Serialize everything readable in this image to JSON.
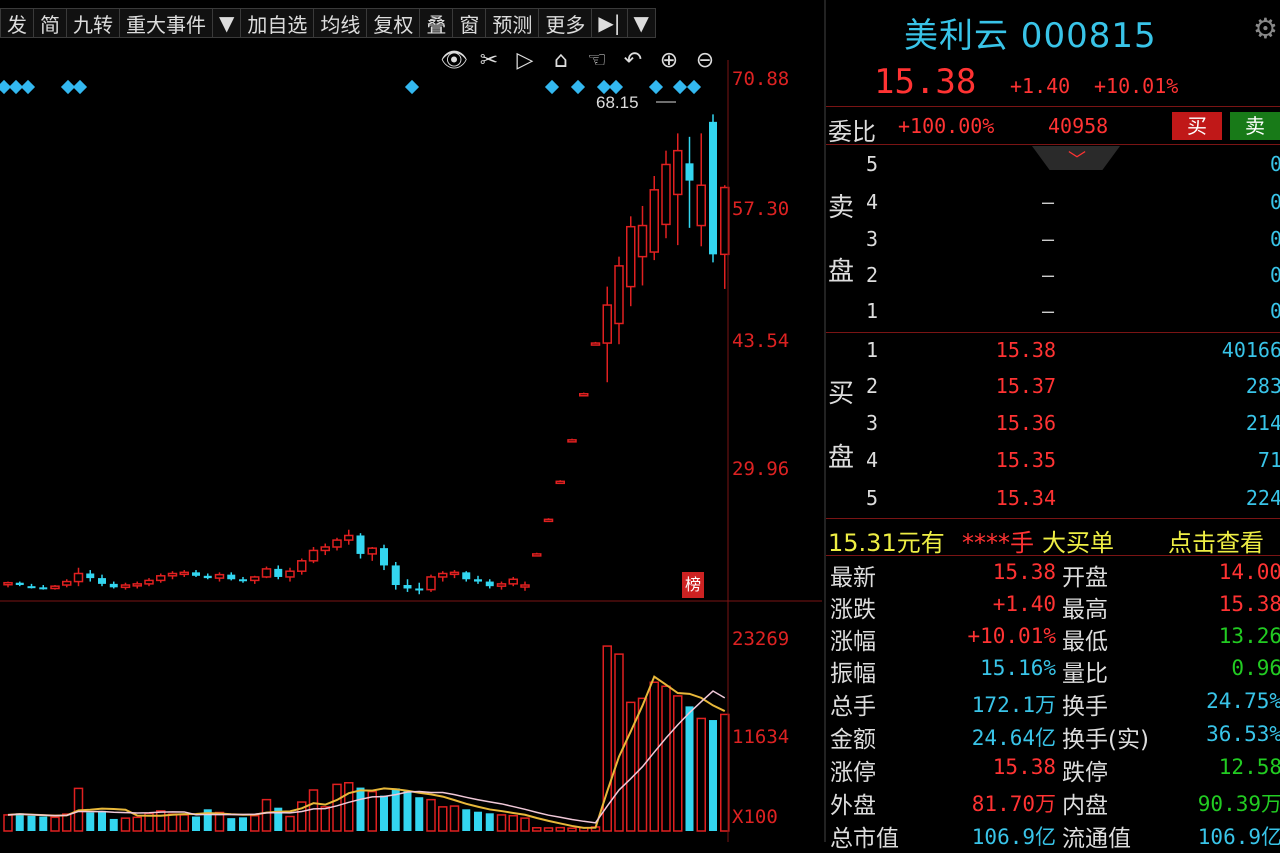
{
  "toolbar": {
    "items": [
      "发",
      "简",
      "九转",
      "重大事件",
      "▼",
      "加自选",
      "均线",
      "复权",
      "叠",
      "窗",
      "预测",
      "更多",
      "▶|",
      "▼"
    ]
  },
  "chart": {
    "price_axis": [
      "70.88",
      "57.30",
      "43.54",
      "29.96"
    ],
    "volume_axis": [
      "23269",
      "11634",
      "X100"
    ],
    "high_label": "68.15",
    "rank_badge": "榜",
    "colors": {
      "up": "#e02020",
      "down": "#33d6f0",
      "ma_yellow": "#e8b83a",
      "ma_pink": "#f0c8d8"
    }
  },
  "chart_data": {
    "type": "candlestick",
    "price_ylim": [
      26,
      72
    ],
    "candles": [
      [
        27.4,
        27.6,
        27.1,
        27.5
      ],
      [
        27.5,
        27.6,
        27.2,
        27.3
      ],
      [
        27.2,
        27.4,
        27.0,
        27.1
      ],
      [
        27.1,
        27.3,
        26.9,
        27.0
      ],
      [
        27.0,
        27.3,
        26.9,
        27.2
      ],
      [
        27.3,
        27.8,
        27.1,
        27.6
      ],
      [
        27.6,
        28.8,
        27.2,
        28.3
      ],
      [
        28.3,
        28.6,
        27.6,
        27.9
      ],
      [
        27.9,
        28.2,
        27.2,
        27.4
      ],
      [
        27.4,
        27.6,
        27.0,
        27.1
      ],
      [
        27.1,
        27.5,
        26.9,
        27.3
      ],
      [
        27.3,
        27.6,
        27.0,
        27.4
      ],
      [
        27.4,
        27.9,
        27.2,
        27.7
      ],
      [
        27.7,
        28.3,
        27.5,
        28.1
      ],
      [
        28.1,
        28.5,
        27.8,
        28.3
      ],
      [
        28.3,
        28.6,
        28.0,
        28.4
      ],
      [
        28.4,
        28.6,
        28.0,
        28.1
      ],
      [
        28.1,
        28.3,
        27.8,
        27.9
      ],
      [
        27.9,
        28.4,
        27.6,
        28.2
      ],
      [
        28.2,
        28.4,
        27.7,
        27.8
      ],
      [
        27.8,
        28.0,
        27.5,
        27.7
      ],
      [
        27.7,
        28.1,
        27.4,
        28.0
      ],
      [
        28.0,
        28.9,
        27.9,
        28.7
      ],
      [
        28.7,
        29.0,
        27.8,
        28.0
      ],
      [
        28.0,
        28.8,
        27.6,
        28.5
      ],
      [
        28.5,
        29.6,
        28.2,
        29.4
      ],
      [
        29.4,
        30.6,
        29.2,
        30.3
      ],
      [
        30.3,
        30.9,
        29.9,
        30.6
      ],
      [
        30.6,
        31.4,
        30.3,
        31.2
      ],
      [
        31.2,
        32.1,
        30.8,
        31.6
      ],
      [
        31.6,
        31.8,
        29.6,
        30.0
      ],
      [
        30.0,
        30.6,
        29.4,
        30.5
      ],
      [
        30.5,
        30.8,
        28.6,
        29.0
      ],
      [
        29.0,
        29.3,
        26.9,
        27.3
      ],
      [
        27.3,
        27.8,
        26.7,
        27.0
      ],
      [
        27.0,
        27.5,
        26.5,
        26.9
      ],
      [
        26.9,
        28.2,
        26.7,
        28.0
      ],
      [
        28.0,
        28.5,
        27.6,
        28.3
      ],
      [
        28.3,
        28.6,
        27.9,
        28.4
      ],
      [
        28.4,
        28.5,
        27.6,
        27.8
      ],
      [
        27.8,
        28.1,
        27.4,
        27.6
      ],
      [
        27.6,
        27.8,
        27.0,
        27.2
      ],
      [
        27.2,
        27.6,
        26.9,
        27.4
      ],
      [
        27.4,
        28.0,
        27.2,
        27.8
      ],
      [
        27.2,
        27.6,
        26.8,
        27.3
      ],
      [
        30.0,
        30.1,
        29.9,
        30.0
      ],
      [
        33.0,
        33.1,
        32.9,
        33.0
      ],
      [
        36.3,
        36.4,
        36.2,
        36.3
      ],
      [
        39.9,
        40.0,
        39.8,
        39.9
      ],
      [
        43.9,
        44.0,
        43.8,
        43.9
      ],
      [
        48.3,
        48.4,
        48.2,
        48.3
      ],
      [
        48.3,
        53.2,
        44.9,
        51.6
      ],
      [
        50.0,
        55.8,
        48.2,
        55.0
      ],
      [
        53.2,
        59.3,
        51.5,
        58.4
      ],
      [
        55.8,
        60.2,
        53.3,
        58.5
      ],
      [
        56.2,
        62.8,
        55.5,
        61.6
      ],
      [
        58.6,
        65.0,
        57.4,
        63.8
      ],
      [
        61.2,
        66.5,
        56.8,
        65.0
      ],
      [
        63.9,
        66.2,
        58.3,
        62.4
      ],
      [
        58.5,
        66.5,
        56.7,
        62.0
      ],
      [
        67.5,
        68.15,
        55.3,
        56.0
      ],
      [
        56.0,
        62.0,
        53.0,
        61.8
      ]
    ],
    "volume_ylim": [
      0,
      25000
    ],
    "volume": [
      2000,
      2200,
      1900,
      1800,
      1700,
      2100,
      5300,
      2300,
      2500,
      1500,
      1600,
      1700,
      2200,
      2500,
      2100,
      2000,
      1800,
      2700,
      2300,
      1600,
      1700,
      1900,
      3900,
      2900,
      1800,
      3600,
      5100,
      3000,
      5800,
      6000,
      5400,
      4900,
      4400,
      5300,
      5000,
      4200,
      3900,
      3000,
      3100,
      2700,
      2400,
      2200,
      2000,
      1900,
      1600,
      400,
      380,
      420,
      350,
      410,
      500,
      23000,
      22000,
      16000,
      16500,
      18500,
      18000,
      16800,
      15500,
      14000,
      13800,
      14500
    ]
  },
  "quote": {
    "name": "美利云 000815",
    "price": "15.38",
    "change": "+1.40",
    "pct": "+10.01%",
    "weibi_label": "委比",
    "weibi_val": "+100.00%",
    "weibi_diff": "40958",
    "buy_btn": "买",
    "sell_btn": "卖",
    "sell_label_1": "卖",
    "sell_label_2": "盘",
    "buy_label_1": "买",
    "buy_label_2": "盘",
    "asks": [
      {
        "lvl": "5",
        "price": "",
        "vol": "0"
      },
      {
        "lvl": "4",
        "price": "—",
        "vol": "0"
      },
      {
        "lvl": "3",
        "price": "—",
        "vol": "0"
      },
      {
        "lvl": "2",
        "price": "—",
        "vol": "0"
      },
      {
        "lvl": "1",
        "price": "—",
        "vol": "0"
      }
    ],
    "bids": [
      {
        "lvl": "1",
        "price": "15.38",
        "vol": "40166"
      },
      {
        "lvl": "2",
        "price": "15.37",
        "vol": "283"
      },
      {
        "lvl": "3",
        "price": "15.36",
        "vol": "214"
      },
      {
        "lvl": "4",
        "price": "15.35",
        "vol": "71"
      },
      {
        "lvl": "5",
        "price": "15.34",
        "vol": "224"
      }
    ],
    "bigorder": {
      "a": "15.31元有",
      "b": "****手",
      "c": "大买单",
      "d": "点击查看"
    },
    "stats": [
      {
        "k1": "最新",
        "v1": "15.38",
        "c1": "red",
        "k2": "开盘",
        "v2": "14.00",
        "c2": "red"
      },
      {
        "k1": "涨跌",
        "v1": "+1.40",
        "c1": "red",
        "k2": "最高",
        "v2": "15.38",
        "c2": "red"
      },
      {
        "k1": "涨幅",
        "v1": "+10.01%",
        "c1": "red",
        "k2": "最低",
        "v2": "13.26",
        "c2": "green"
      },
      {
        "k1": "振幅",
        "v1": "15.16%",
        "c1": "cyan",
        "k2": "量比",
        "v2": "0.96",
        "c2": "green"
      },
      {
        "k1": "总手",
        "v1": "172.1万",
        "c1": "cyan",
        "k2": "换手",
        "v2": "24.75%",
        "c2": "cyan"
      },
      {
        "k1": "金额",
        "v1": "24.64亿",
        "c1": "cyan",
        "k2": "换手(实)",
        "v2": "36.53%",
        "c2": "cyan"
      },
      {
        "k1": "涨停",
        "v1": "15.38",
        "c1": "red",
        "k2": "跌停",
        "v2": "12.58",
        "c2": "green"
      },
      {
        "k1": "外盘",
        "v1": "81.70万",
        "c1": "red",
        "k2": "内盘",
        "v2": "90.39万",
        "c2": "green"
      },
      {
        "k1": "总市值",
        "v1": "106.9亿",
        "c1": "cyan",
        "k2": "流通值",
        "v2": "106.9亿",
        "c2": "cyan"
      }
    ]
  }
}
